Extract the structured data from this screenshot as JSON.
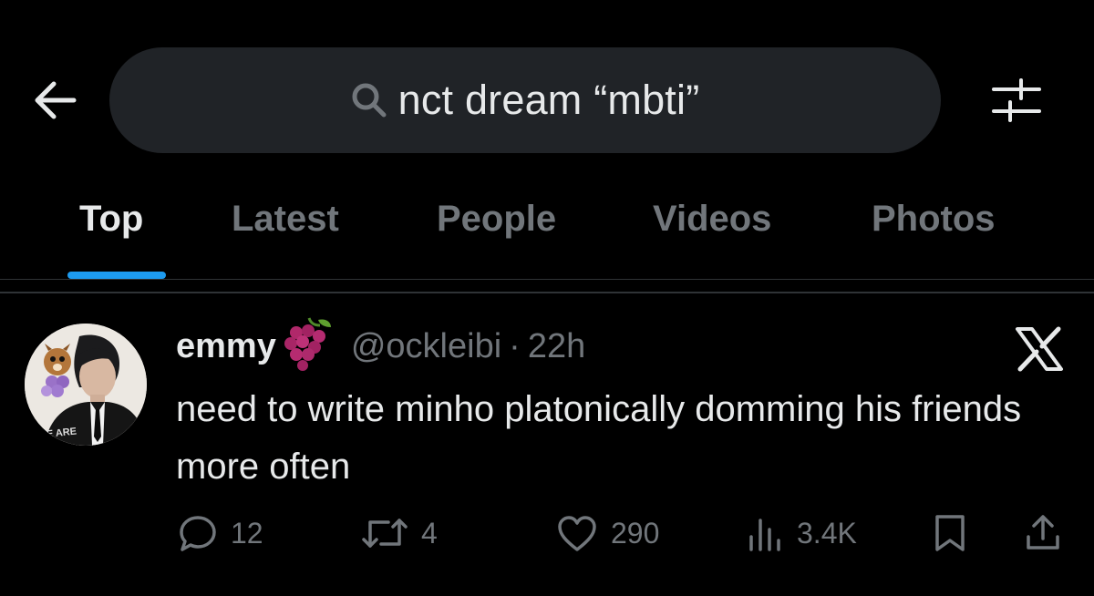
{
  "search": {
    "query": "nct dream “mbti”"
  },
  "tabs": [
    {
      "label": "Top",
      "active": true
    },
    {
      "label": "Latest",
      "active": false
    },
    {
      "label": "People",
      "active": false
    },
    {
      "label": "Videos",
      "active": false
    },
    {
      "label": "Photos",
      "active": false
    }
  ],
  "tweet": {
    "name": "emmy",
    "name_emoji": "grapes",
    "handle": "@ockleibi",
    "separator": "·",
    "time": "22h",
    "text": "need to write minho platonically domming his friends more often",
    "avatar_caption": "WE ARE",
    "stats": {
      "replies": "12",
      "retweets": "4",
      "likes": "290",
      "views": "3.4K"
    }
  },
  "icons": {
    "back": "arrow-left-icon",
    "search": "search-icon",
    "filter": "sliders-icon",
    "close": "x-icon",
    "reply": "reply-icon",
    "retweet": "retweet-icon",
    "like": "heart-icon",
    "views": "bar-chart-icon",
    "bookmark": "bookmark-icon",
    "share": "share-icon"
  },
  "colors": {
    "background": "#000000",
    "search_bg": "#202327",
    "text": "#e7e9ea",
    "muted": "#71767b",
    "accent": "#1d9bf0",
    "divider": "#2f3336"
  }
}
